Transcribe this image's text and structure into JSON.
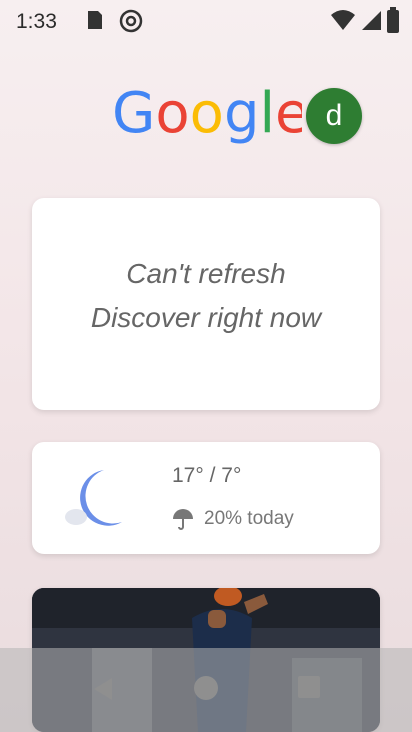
{
  "status": {
    "time": "1:33"
  },
  "google": {
    "avatar_letter": "d"
  },
  "error_card": {
    "line1": "Can't refresh",
    "line2": "Discover right now"
  },
  "weather": {
    "temp": "17° / 7°",
    "rain": "20% today"
  },
  "colors": {
    "avatar_bg": "#2e7d32",
    "moon": "#6b8fe8"
  }
}
